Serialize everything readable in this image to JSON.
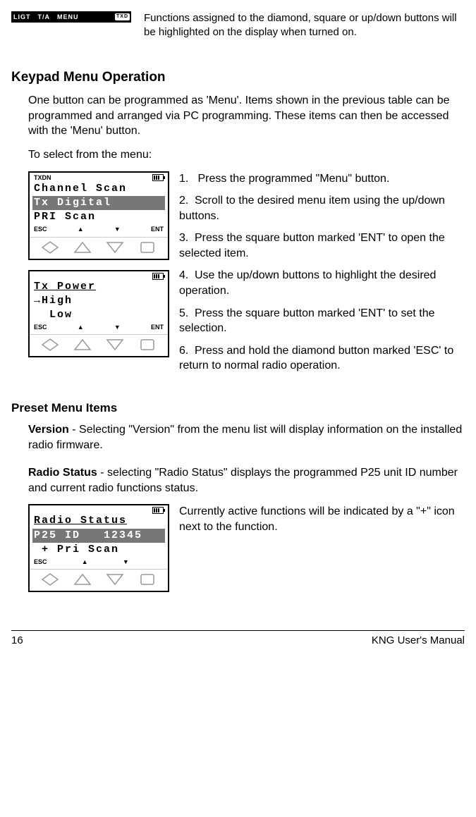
{
  "top_bar": {
    "l1": "LIGT",
    "l2": "T/A",
    "l3": "MENU",
    "txd": "TXD"
  },
  "top_text": "Functions assigned to the diamond, square or up/down buttons will be highlighted on the display when turned on.",
  "h_keypad": "Keypad Menu Operation",
  "keypad_p1": "One button can be programmed as 'Menu'. Items shown in the previous table can be programmed and arranged via PC programming. These items can then be accessed with the 'Menu' button.",
  "keypad_p2": "To select from the menu:",
  "lcd1": {
    "hdr": "TXDN",
    "line1": "Channel Scan",
    "line2": "Tx Digital",
    "line3": "PRI Scan",
    "sk1": "ESC",
    "sk2": "▲",
    "sk3": "▼",
    "sk4": "ENT"
  },
  "lcd2": {
    "line1": "Tx Power",
    "line2": "→High",
    "line3": "  Low",
    "sk1": "ESC",
    "sk2": "▲",
    "sk3": "▼",
    "sk4": "ENT"
  },
  "steps": {
    "s1": "Press the programmed \"Menu\" button.",
    "s2": "Scroll to the desired menu item using the up/down buttons.",
    "s3": "Press the square button marked 'ENT' to open the selected item.",
    "s4": "Use the up/down buttons to highlight the desired operation.",
    "s5": "Press the square button marked 'ENT' to set the selection.",
    "s6": "Press and hold the diamond button marked 'ESC' to return to normal radio operation."
  },
  "h_preset": "Preset Menu Items",
  "version_label": "Version",
  "version_text": " - Selecting \"Version\" from the menu list will display information on the installed radio firmware.",
  "radio_label": "Radio Status",
  "radio_text": " -  selecting \"Radio Status\" displays the programmed P25 unit ID number and current radio functions status.",
  "lcd3": {
    "line1": "Radio Status",
    "line2": "P25 ID   12345",
    "line3": " + Pri Scan",
    "sk1": "ESC",
    "sk2": "▲",
    "sk3": "▼"
  },
  "radio_side": "Currently active functions will be indicated by a \"+\" icon next to the function.",
  "footer_page": "16",
  "footer_title": "KNG User's Manual"
}
